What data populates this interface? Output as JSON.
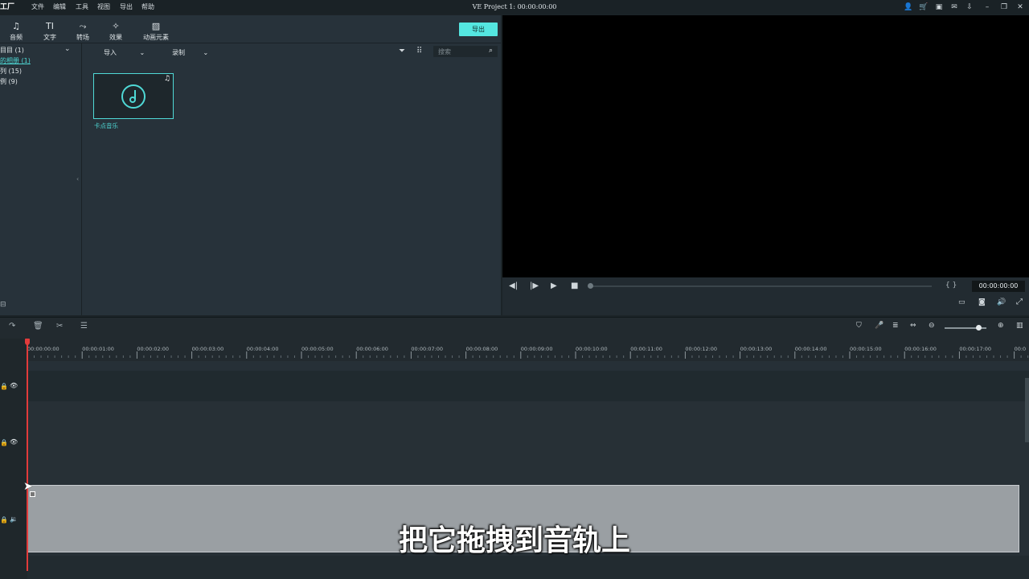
{
  "app": {
    "logo": "工厂",
    "title": "VE Project 1: 00:00:00:00"
  },
  "menu": [
    "文件",
    "编辑",
    "工具",
    "视图",
    "导出",
    "帮助"
  ],
  "toolbar": {
    "tools": [
      {
        "label": "音频",
        "icon": "music-note-icon"
      },
      {
        "label": "文字",
        "icon": "text-icon"
      },
      {
        "label": "转场",
        "icon": "transition-icon"
      },
      {
        "label": "效果",
        "icon": "effects-icon"
      },
      {
        "label": "动画元素",
        "icon": "image-icon"
      }
    ],
    "export_label": "导出"
  },
  "sidebar": {
    "items": [
      {
        "label": "目目 (1)"
      },
      {
        "label": "的相册 (1)"
      },
      {
        "label": "列 (15)"
      },
      {
        "label": "例 (9)"
      }
    ]
  },
  "media": {
    "import_label": "导入",
    "record_label": "录制",
    "search_placeholder": "搜索",
    "items": [
      {
        "label": "卡点音乐",
        "icon": "music-disc-icon"
      }
    ]
  },
  "preview": {
    "timecode": "00:00:00:00",
    "markers": "{  }"
  },
  "timeline": {
    "ticks": [
      "00:00:00:00",
      "00:00:01:00",
      "00:00:02:00",
      "00:00:03:00",
      "00:00:04:00",
      "00:00:05:00",
      "00:00:06:00",
      "00:00:07:00",
      "00:00:08:00",
      "00:00:09:00",
      "00:00:10:00",
      "00:00:11:00",
      "00:00:12:00",
      "00:00:13:00",
      "00:00:14:00",
      "00:00:15:00",
      "00:00:16:00",
      "00:00:17:00",
      "00:0"
    ]
  },
  "subtitle": "把它拖拽到音轨上",
  "colors": {
    "accent": "#4fd9d6",
    "export_button": "#54e6e0",
    "playhead": "#e23b3b"
  }
}
